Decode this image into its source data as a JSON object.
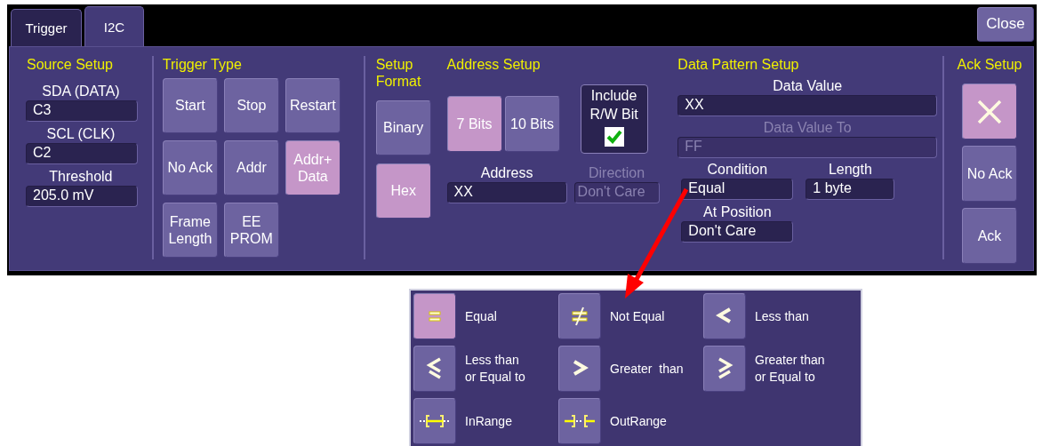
{
  "tabs": [
    {
      "label": "Trigger",
      "selected": false
    },
    {
      "label": "I2C",
      "selected": true
    }
  ],
  "close_button": "Close",
  "source_setup": {
    "title": "Source Setup",
    "fields": [
      {
        "label": "SDA (DATA)",
        "value": "C3"
      },
      {
        "label": "SCL (CLK)",
        "value": "C2"
      },
      {
        "label": "Threshold",
        "value": "205.0 mV"
      }
    ]
  },
  "trigger_type": {
    "title": "Trigger Type",
    "buttons": [
      {
        "label": "Start",
        "selected": false
      },
      {
        "label": "Stop",
        "selected": false
      },
      {
        "label": "Restart",
        "selected": false
      },
      {
        "label": "No Ack",
        "selected": false
      },
      {
        "label": "Addr",
        "selected": false
      },
      {
        "label": "Addr+\nData",
        "selected": true
      },
      {
        "label": "Frame\nLength",
        "selected": false
      },
      {
        "label": "EE\nPROM",
        "selected": false
      }
    ]
  },
  "setup_format": {
    "title": "Setup\nFormat",
    "buttons": [
      {
        "label": "Binary",
        "selected": false
      },
      {
        "label": "Hex",
        "selected": true
      }
    ]
  },
  "address_setup": {
    "title": "Address Setup",
    "bits": [
      {
        "label": "7 Bits",
        "selected": true
      },
      {
        "label": "10 Bits",
        "selected": false
      }
    ],
    "include_rw": {
      "label": "Include\nR/W Bit",
      "checked": true
    },
    "address": {
      "label": "Address",
      "value": "XX"
    },
    "direction": {
      "label": "Direction",
      "value": "Don't Care",
      "disabled": true
    }
  },
  "data_pattern_setup": {
    "title": "Data Pattern Setup",
    "data_value": {
      "label": "Data Value",
      "value": "XX",
      "disabled": false
    },
    "data_value_to": {
      "label": "Data Value To",
      "value": "FF",
      "disabled": true
    },
    "condition": {
      "label": "Condition",
      "value": "Equal"
    },
    "length": {
      "label": "Length",
      "value": "1 byte"
    },
    "at_position": {
      "label": "At Position",
      "value": "Don't Care"
    }
  },
  "ack_setup": {
    "title": "Ack Setup",
    "buttons": [
      {
        "kind": "cross",
        "selected": true
      },
      {
        "kind": "text",
        "label": "No Ack",
        "selected": false
      },
      {
        "kind": "text",
        "label": "Ack",
        "selected": false
      }
    ]
  },
  "condition_menu": [
    {
      "kind": "eq",
      "label": "Equal",
      "selected": true
    },
    {
      "kind": "ne",
      "label": "Not Equal",
      "selected": false
    },
    {
      "kind": "lt",
      "label": "Less than",
      "selected": false
    },
    {
      "kind": "le",
      "label": "Less than\nor Equal to",
      "selected": false
    },
    {
      "kind": "gt",
      "label": "Greater  than",
      "selected": false
    },
    {
      "kind": "ge",
      "label": "Greater than\nor Equal to",
      "selected": false
    },
    {
      "kind": "inrange",
      "label": "InRange",
      "selected": false
    },
    {
      "kind": "outrange",
      "label": "OutRange",
      "selected": false
    }
  ]
}
